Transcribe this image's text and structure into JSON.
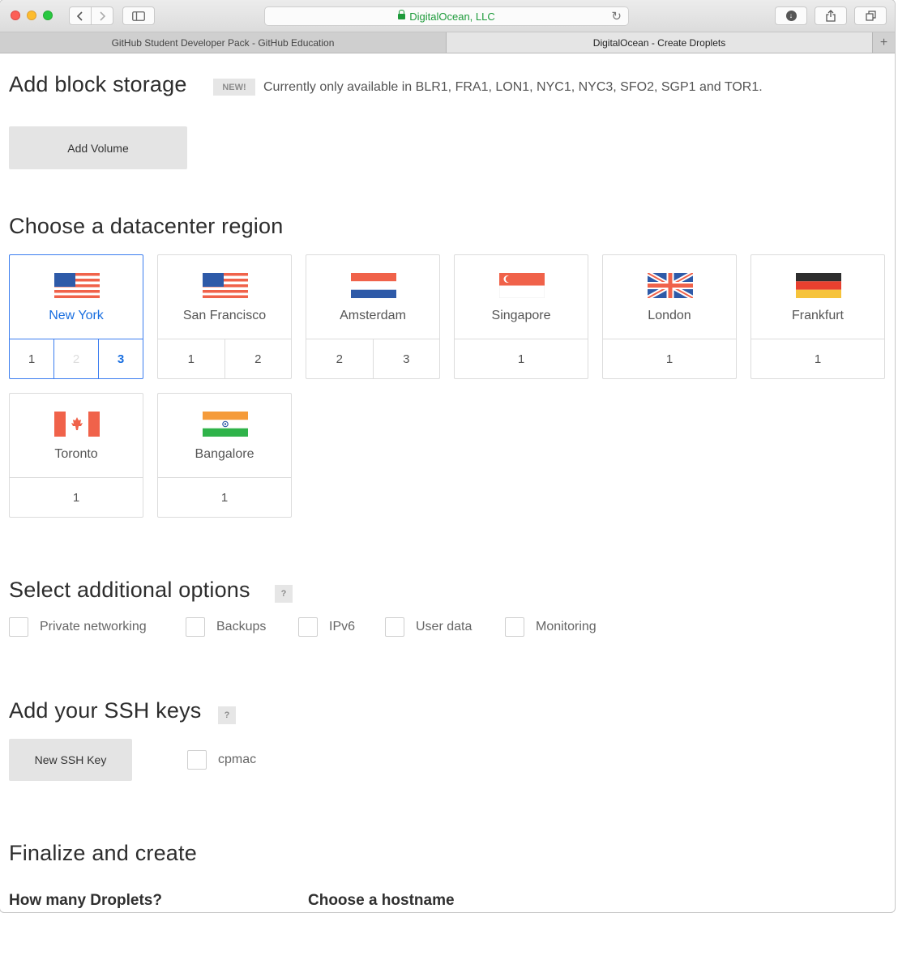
{
  "browser": {
    "address": "DigitalOcean, LLC",
    "tabs": [
      {
        "label": "GitHub Student Developer Pack - GitHub Education"
      },
      {
        "label": "DigitalOcean - Create Droplets"
      }
    ]
  },
  "block_storage": {
    "title": "Add block storage",
    "badge": "NEW!",
    "availability": "Currently only available in BLR1, FRA1, LON1, NYC1, NYC3, SFO2, SGP1 and TOR1.",
    "add_volume_label": "Add Volume"
  },
  "regions": {
    "title": "Choose a datacenter region",
    "items": [
      {
        "name": "New York",
        "flag": "us-flag-icon",
        "datacenters": [
          "1",
          "2",
          "3"
        ]
      },
      {
        "name": "San Francisco",
        "flag": "us-flag-icon",
        "datacenters": [
          "1",
          "2"
        ]
      },
      {
        "name": "Amsterdam",
        "flag": "netherlands-flag-icon",
        "datacenters": [
          "2",
          "3"
        ]
      },
      {
        "name": "Singapore",
        "flag": "singapore-flag-icon",
        "datacenters": [
          "1"
        ]
      },
      {
        "name": "London",
        "flag": "uk-flag-icon",
        "datacenters": [
          "1"
        ]
      },
      {
        "name": "Frankfurt",
        "flag": "germany-flag-icon",
        "datacenters": [
          "1"
        ]
      },
      {
        "name": "Toronto",
        "flag": "canada-flag-icon",
        "datacenters": [
          "1"
        ]
      },
      {
        "name": "Bangalore",
        "flag": "india-flag-icon",
        "datacenters": [
          "1"
        ]
      }
    ],
    "selected_region": "New York",
    "selected_datacenter": "3",
    "disabled_datacenter": "2"
  },
  "options": {
    "title": "Select additional options",
    "help": "?",
    "items": [
      "Private networking",
      "Backups",
      "IPv6",
      "User data",
      "Monitoring"
    ]
  },
  "ssh": {
    "title": "Add your SSH keys",
    "help": "?",
    "new_key_label": "New SSH Key",
    "keys": [
      "cpmac"
    ]
  },
  "finalize": {
    "title": "Finalize and create",
    "droplets_label": "How many Droplets?",
    "hostname_label": "Choose a hostname"
  },
  "colors": {
    "accent": "#3c7ef0",
    "secure_green": "#1d9a3a"
  }
}
